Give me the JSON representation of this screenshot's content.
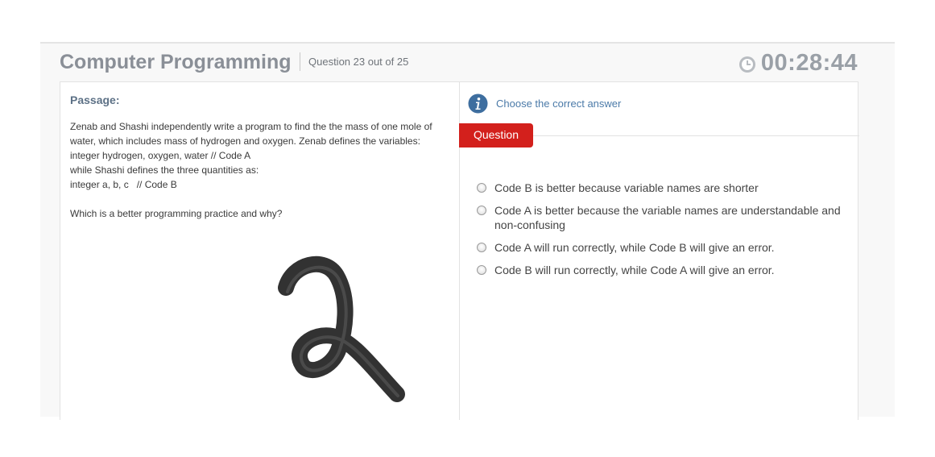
{
  "header": {
    "title": "Computer Programming",
    "question_counter": "Question 23 out of 25",
    "timer": "00:28:44",
    "timer_icon": "clock-icon"
  },
  "passage": {
    "label": "Passage:",
    "lines": [
      "Zenab and Shashi independently write a program to find the the mass of one mole of",
      "water, which includes mass of hydrogen and oxygen. Zenab defines the variables:",
      "integer hydrogen, oxygen, water // Code A",
      "while Shashi defines the three quantities as:",
      "integer a, b, c   // Code B",
      "",
      "Which is a better programming practice and why?"
    ]
  },
  "question_panel": {
    "instruction_icon": "info-icon",
    "instruction": "Choose the correct answer",
    "tab_label": "Question",
    "options": [
      {
        "label": "Code B is better because variable names are shorter"
      },
      {
        "label": "Code A is better because the variable names are understandable and non-confusing"
      },
      {
        "label": "Code A will run correctly, while Code B will give an error."
      },
      {
        "label": "Code B will run correctly, while Code A will give an error."
      }
    ]
  },
  "colors": {
    "title": "#8a8f97",
    "accent_red": "#d3201c",
    "link_blue": "#4b7aa8",
    "passage_label": "#5d7186"
  }
}
